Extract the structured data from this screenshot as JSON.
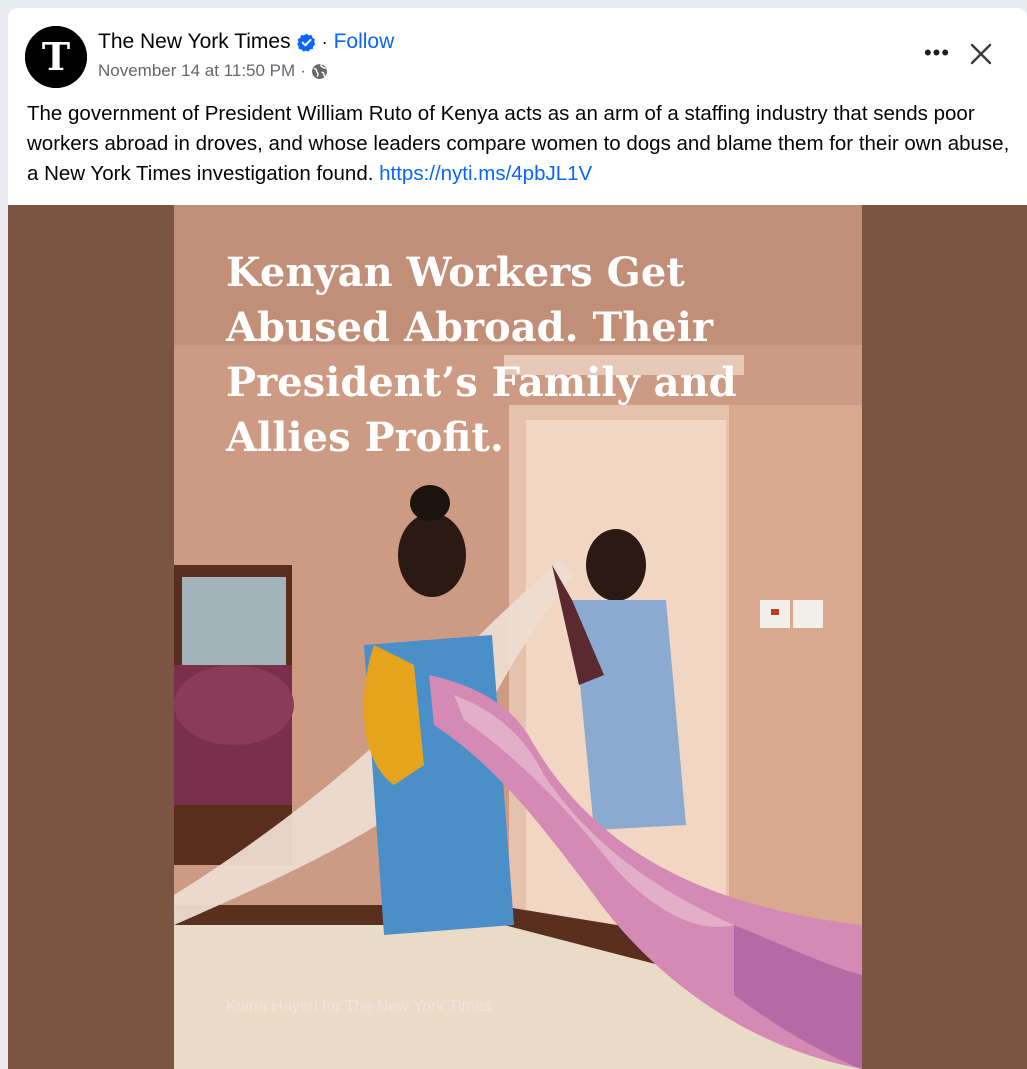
{
  "post": {
    "page_name": "The New York Times",
    "follow_label": "Follow",
    "separator": "·",
    "timestamp": "November 14 at 11:50 PM",
    "meta_separator": "·",
    "avatar_glyph": "T",
    "icons": {
      "avatar": "nyt-logo-icon",
      "verified": "verified-badge-icon",
      "audience": "globe-icon",
      "more": "more-options-icon",
      "close": "close-icon"
    },
    "more_label": "•••",
    "text": "The government of President William Ruto of Kenya acts as an arm of a staffing industry that sends poor workers abroad in droves, and whose leaders compare women to dogs and blame them for their own abuse, a New York Times investigation found.",
    "link": "https://nyti.ms/4pbJL1V"
  },
  "media": {
    "headline": "Kenyan Workers Get Abused Abroad. Their President’s Family and Allies Profit.",
    "photo_credit": "Kiana Hayeri for The New York Times"
  },
  "colors": {
    "link": "#0866ff",
    "verified": "#0866ff",
    "media_background": "#7b5542",
    "secondary_text": "#65676b"
  }
}
